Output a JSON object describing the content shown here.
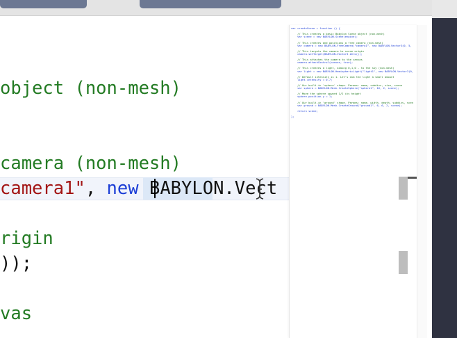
{
  "editor": {
    "lines": [
      {
        "key": "l1",
        "parts": [
          {
            "cls": "cmt",
            "text": "object (non-mesh)"
          }
        ]
      },
      {
        "key": "l2",
        "parts": [
          {
            "cls": "cmt",
            "text": "camera (non-mesh)"
          }
        ]
      },
      {
        "key": "l3",
        "parts": [
          {
            "cls": "str",
            "text": "camera1\""
          },
          {
            "cls": "",
            "text": ", "
          },
          {
            "cls": "kw",
            "text": "new"
          },
          {
            "cls": "",
            "text": " BABYLON.Vect"
          }
        ]
      },
      {
        "key": "l4",
        "parts": [
          {
            "cls": "cmt",
            "text": "rigin"
          }
        ]
      },
      {
        "key": "l5",
        "parts": [
          {
            "cls": "",
            "text": "));"
          }
        ]
      },
      {
        "key": "l6",
        "parts": [
          {
            "cls": "cmt",
            "text": "vas"
          }
        ]
      }
    ]
  },
  "minimap": {
    "lines": [
      "var createScene = function () {",
      "",
      "    // This creates a basic Babylon Scene object (non-mesh)",
      "    var scene = new BABYLON.Scene(engine);",
      "",
      "    // This creates and positions a free camera (non-mesh)",
      "    var camera = new BABYLON.FreeCamera(\"camera1\", new BABYLON.Vector3(0, 5,",
      "",
      "    // This targets the camera to scene origin",
      "    camera.setTarget(BABYLON.Vector3.Zero());",
      "",
      "    // This attaches the camera to the canvas",
      "    camera.attachControl(canvas, true);",
      "",
      "    // This creates a light, aiming 0,1,0 - to the sky (non-mesh)",
      "    var light = new BABYLON.HemisphericLight(\"light1\", new BABYLON.Vector3(0,",
      "",
      "    // Default intensity is 1. Let's dim the light a small amount",
      "    light.intensity = 0.7;",
      "",
      "    // Our built-in 'sphere' shape. Params: name, subdivs, size, scene",
      "    var sphere = BABYLON.Mesh.CreateSphere(\"sphere1\", 16, 2, scene);",
      "",
      "    // Move the sphere upward 1/2 its height",
      "    sphere.position.y = 1;",
      "",
      "    // Our built-in 'ground' shape. Params: name, width, depth, subdivs, scen",
      "    var ground = BABYLON.Mesh.CreateGround(\"ground1\", 6, 6, 2, scene);",
      "",
      "    return scene;",
      "",
      "};"
    ]
  }
}
